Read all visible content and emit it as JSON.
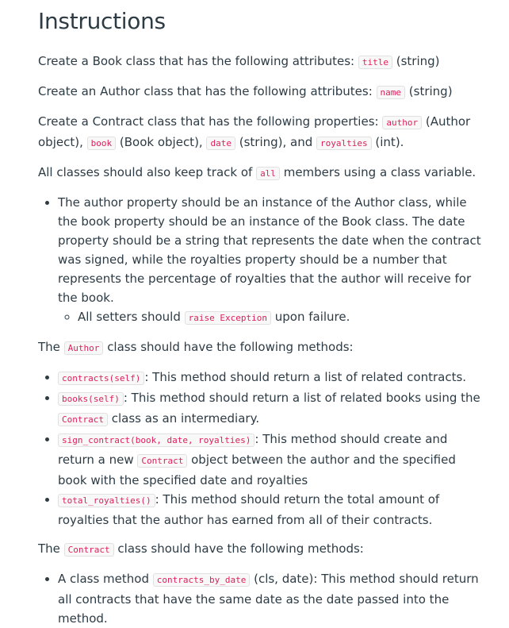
{
  "heading": "Instructions",
  "p1": {
    "pre": "Create a Book class that has the following attributes: ",
    "code": "title",
    "post": " (string)"
  },
  "p2": {
    "pre": "Create an Author class that has the following attributes: ",
    "code": "name",
    "post": " (string)"
  },
  "p3": {
    "pre": "Create a Contract class that has the following properties: ",
    "code1": "author",
    "mid1": " (Author object), ",
    "code2": "book",
    "mid2": " (Book object), ",
    "code3": "date",
    "mid3": " (string), and ",
    "code4": "royalties",
    "post": " (int)."
  },
  "p4": {
    "pre": "All classes should also keep track of ",
    "code": "all",
    "post": " members using a class variable."
  },
  "bullet_property": "The author property should be an instance of the Author class, while the book property should be an instance of the Book class. The date property should be a string that represents the date when the contract was signed, while the royalties property should be a number that represents the percentage of royalties that the author will receive for the book.",
  "sub_setters": {
    "pre": "All setters should ",
    "code": "raise Exception",
    "post": " upon failure."
  },
  "author_methods_intro": {
    "pre": "The ",
    "code": "Author",
    "post": " class should have the following methods:"
  },
  "author_methods": [
    {
      "code": "contracts(self)",
      "text": ": This method should return a list of related contracts."
    },
    {
      "code": "books(self)",
      "text": ": This method should return a list of related books using the ",
      "code2": "Contract",
      "text2": " class as an intermediary."
    },
    {
      "code": "sign_contract(book, date, royalties)",
      "text": ": This method should create and return a new ",
      "code2": "Contract",
      "text2": " object between the author and the specified book with the specified date and royalties"
    },
    {
      "code": "total_royalties()",
      "text": ": This method should return the total amount of royalties that the author has earned from all of their contracts."
    }
  ],
  "contract_methods_intro": {
    "pre": "The ",
    "code": "Contract",
    "post": " class should have the following methods:"
  },
  "contract_methods": [
    {
      "pre": "A class method ",
      "code": "contracts_by_date",
      "text": " (cls, date): This method should return all contracts that have the same date as the date passed into the method."
    }
  ]
}
